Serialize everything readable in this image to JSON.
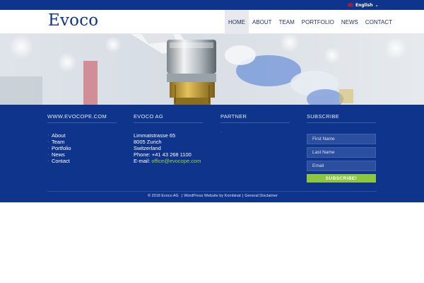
{
  "topbar": {
    "language": "English",
    "flag_icon": "uk-flag-icon",
    "chevron_icon": "chevron-down-icon"
  },
  "header": {
    "logo": "Evoco",
    "nav": [
      {
        "label": "HOME",
        "active": true
      },
      {
        "label": "ABOUT"
      },
      {
        "label": "TEAM"
      },
      {
        "label": "PORTFOLIO"
      },
      {
        "label": "NEWS"
      },
      {
        "label": "CONTACT"
      }
    ]
  },
  "hero": {
    "slides": 2,
    "active_slide": 1
  },
  "footer": {
    "col1": {
      "title": "WWW.EVOCOPE.COM",
      "links": [
        "About",
        "Team",
        "Portfolio",
        "News",
        "Contact"
      ]
    },
    "col2": {
      "title": "EVOCO AG",
      "street": "Limmatstrasse 65",
      "city": "8005 Zurich",
      "country": "Switzerland",
      "phone": "Phone: +41 43 268 1100",
      "email_label": "E-mail: ",
      "email": "office@evocope.com"
    },
    "col3": {
      "title": "PARTNER",
      "bullet": "·"
    },
    "col4": {
      "title": "SUBSCRIBE",
      "first_name": "First Name",
      "last_name": "Last Name",
      "email": "Email",
      "button": "SUBSCRIBE!"
    },
    "copyright": {
      "text": "© 2018 Evoco AG",
      "sep": "|",
      "wordpress": "WordPress Website by Kombinat",
      "disclaimer": "General Disclaimer"
    }
  },
  "colors": {
    "primary": "#0f348b",
    "accent": "#8dc63f",
    "link_green": "#9ed43a"
  }
}
